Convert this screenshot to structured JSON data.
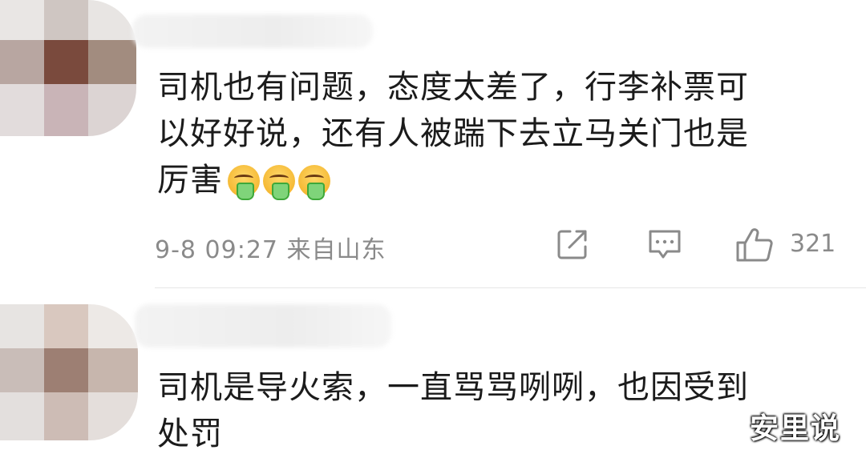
{
  "comments": [
    {
      "text_lines": [
        "司机也有问题，态度太差了，行李补票可",
        "以好好说，还有人被踹下去立马关门也是",
        "厉害"
      ],
      "emojis": [
        "vomit-emoji",
        "vomit-emoji",
        "vomit-emoji"
      ],
      "timestamp": "9-8 09:27",
      "location": "来自山东",
      "like_count": "321"
    },
    {
      "text_lines": [
        "司机是导火索，一直骂骂咧咧，也因受到",
        "处罚"
      ]
    }
  ],
  "watermark": "安里说",
  "colors": {
    "meta_text": "#8a8a8a",
    "body_text": "#1b1b1b",
    "divider": "#e6e6e6"
  },
  "icons": {
    "share": "share-edit-icon",
    "comment": "comment-bubble-icon",
    "like": "thumbs-up-icon"
  }
}
